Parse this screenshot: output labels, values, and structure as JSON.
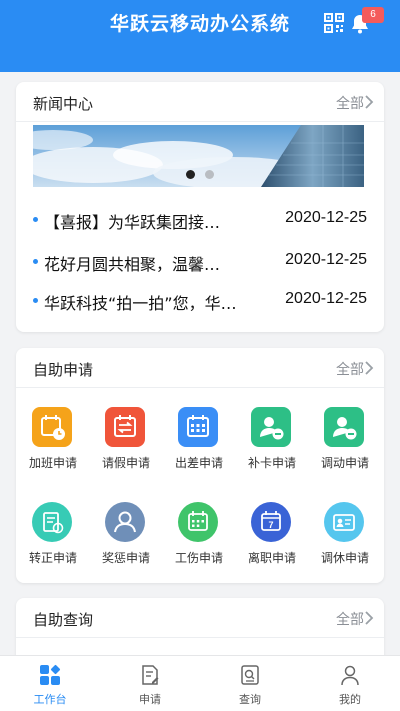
{
  "header": {
    "title": "华跃云移动办公系统",
    "notification_count": "6"
  },
  "news": {
    "title": "新闻中心",
    "more": "全部",
    "items": [
      {
        "title": "【喜报】为华跃集团接…",
        "date": "2020-12-25"
      },
      {
        "title": "花好月圆共相聚，温馨…",
        "date": "2020-12-25"
      },
      {
        "title": "华跃科技“拍一拍”您，华…",
        "date": "2020-12-25"
      }
    ]
  },
  "self_apply": {
    "title": "自助申请",
    "more": "全部",
    "items": [
      {
        "label": "加班申请",
        "icon": "overtime-calendar-icon",
        "color": "#f5a31a"
      },
      {
        "label": "请假申请",
        "icon": "leave-calendar-icon",
        "color": "#f0553a"
      },
      {
        "label": "出差申请",
        "icon": "business-trip-calendar-icon",
        "color": "#3a8ef6"
      },
      {
        "label": "补卡申请",
        "icon": "user-minus-icon",
        "color": "#2dbf86"
      },
      {
        "label": "调动申请",
        "icon": "user-transfer-icon",
        "color": "#2dbf86"
      },
      {
        "label": "转正申请",
        "icon": "regularization-icon",
        "color": "#37cbb5"
      },
      {
        "label": "奖惩申请",
        "icon": "reward-user-icon",
        "color": "#6f8fb8"
      },
      {
        "label": "工伤申请",
        "icon": "injury-calendar-icon",
        "color": "#3fc46a"
      },
      {
        "label": "离职申请",
        "icon": "resign-calendar-icon",
        "color": "#3a63d6"
      },
      {
        "label": "调休申请",
        "icon": "time-off-card-icon",
        "color": "#55c6ee"
      }
    ]
  },
  "self_query": {
    "title": "自助查询",
    "more": "全部"
  },
  "tabbar": {
    "active_color": "#2a8cf3",
    "tabs": [
      {
        "label": "工作台",
        "icon": "workbench-icon",
        "active": true
      },
      {
        "label": "申请",
        "icon": "apply-icon",
        "active": false
      },
      {
        "label": "查询",
        "icon": "query-icon",
        "active": false
      },
      {
        "label": "我的",
        "icon": "profile-icon",
        "active": false
      }
    ]
  }
}
